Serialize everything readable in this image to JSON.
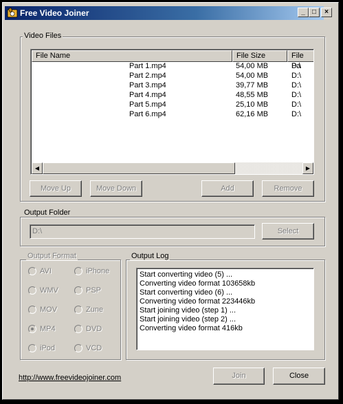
{
  "window": {
    "title": "Free Video Joiner",
    "minimize_label": "_",
    "maximize_label": "□",
    "close_label": "×"
  },
  "video_files": {
    "group_label": "Video Files",
    "columns": [
      "File Name",
      "File Size",
      "File Pa"
    ],
    "rows": [
      {
        "name": "Part 1.mp4",
        "size": "54,00 MB",
        "path": "D:\\"
      },
      {
        "name": "Part 2.mp4",
        "size": "54,00 MB",
        "path": "D:\\"
      },
      {
        "name": "Part 3.mp4",
        "size": "39,77 MB",
        "path": "D:\\"
      },
      {
        "name": "Part 4.mp4",
        "size": "48,55 MB",
        "path": "D:\\"
      },
      {
        "name": "Part 5.mp4",
        "size": "25,10 MB",
        "path": "D:\\"
      },
      {
        "name": "Part 6.mp4",
        "size": "62,16 MB",
        "path": "D:\\"
      }
    ],
    "move_up_label": "Move Up",
    "move_down_label": "Move Down",
    "add_label": "Add",
    "remove_label": "Remove"
  },
  "output_folder": {
    "group_label": "Output Folder",
    "path_value": "D:\\",
    "select_label": "Select"
  },
  "output_format": {
    "group_label": "Output Format",
    "options": [
      "AVI",
      "iPhone",
      "WMV",
      "PSP",
      "MOV",
      "Zune",
      "MP4",
      "DVD",
      "iPod",
      "VCD"
    ],
    "selected": "MP4"
  },
  "output_log": {
    "group_label": "Output Log",
    "lines": [
      "Start converting video (5) ...",
      "Converting video format 103658kb",
      "Start converting video (6) ...",
      "Converting video format 223446kb",
      "Start joining video (step 1) ...",
      "Start joining video (step 2) ...",
      "Converting video format 416kb"
    ]
  },
  "footer": {
    "website": "http://www.freevideojoiner.com",
    "join_label": "Join",
    "close_label": "Close"
  }
}
